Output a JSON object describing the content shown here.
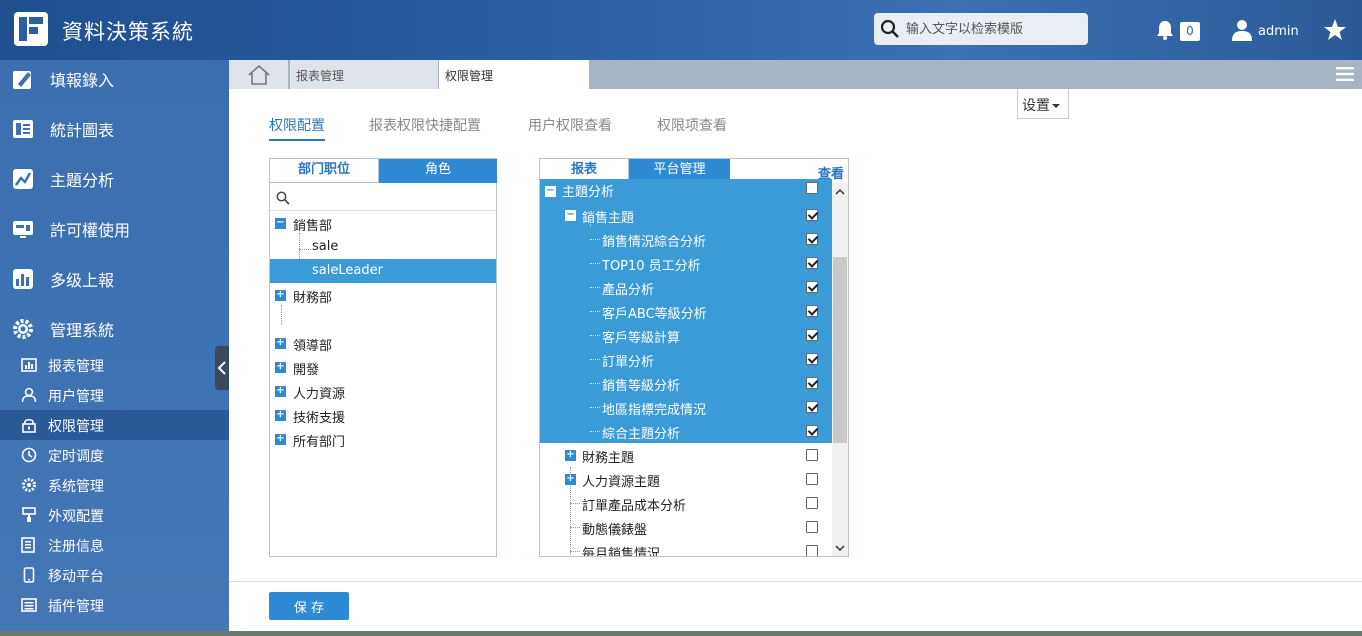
{
  "app": {
    "title": "資料決策系統"
  },
  "header": {
    "search_placeholder": "输入文字以检索模版",
    "notification_count": "0",
    "user": "admin"
  },
  "sidebar": {
    "main_items": [
      {
        "label": "填報錄入",
        "icon": "form-edit-icon"
      },
      {
        "label": "統計圖表",
        "icon": "chart-doc-icon"
      },
      {
        "label": "主題分析",
        "icon": "analysis-icon"
      },
      {
        "label": "許可權使用",
        "icon": "permission-icon"
      },
      {
        "label": "多级上報",
        "icon": "bar-chart-icon"
      },
      {
        "label": "管理系統",
        "icon": "gear-icon"
      }
    ],
    "sub_items": [
      {
        "label": "报表管理",
        "icon": "report-icon"
      },
      {
        "label": "用户管理",
        "icon": "user-icon"
      },
      {
        "label": "权限管理",
        "icon": "lock-icon",
        "active": true
      },
      {
        "label": "定时调度",
        "icon": "clock-icon"
      },
      {
        "label": "系统管理",
        "icon": "cog-icon"
      },
      {
        "label": "外观配置",
        "icon": "brush-icon"
      },
      {
        "label": "注册信息",
        "icon": "register-icon"
      },
      {
        "label": "移动平台",
        "icon": "mobile-icon"
      },
      {
        "label": "插件管理",
        "icon": "plugin-icon"
      }
    ]
  },
  "tabs": {
    "tab1": "报表管理",
    "tab2": "权限管理"
  },
  "settings_label": "设置",
  "sub_tabs": [
    "权限配置",
    "报表权限快捷配置",
    "用户权限查看",
    "权限项查看"
  ],
  "left_panel": {
    "tab1": "部门职位",
    "tab2": "角色",
    "tree": [
      {
        "label": "銷售部",
        "level": 0,
        "expanded": true
      },
      {
        "label": "sale",
        "level": 1
      },
      {
        "label": "saleLeader",
        "level": 1,
        "selected": true
      },
      {
        "label": "財務部",
        "level": 0,
        "expanded": false
      },
      {
        "label": "",
        "level": 1
      },
      {
        "label": "領導部",
        "level": 0,
        "expanded": false
      },
      {
        "label": "開發",
        "level": 0,
        "expanded": false
      },
      {
        "label": "人力資源",
        "level": 0,
        "expanded": false
      },
      {
        "label": "技術支援",
        "level": 0,
        "expanded": false
      },
      {
        "label": "所有部门",
        "level": 0,
        "expanded": false
      }
    ]
  },
  "right_panel": {
    "tab1": "报表",
    "tab2": "平台管理",
    "view_label": "查看",
    "rows": [
      {
        "label": "主題分析",
        "level": 0,
        "toggle": "minus",
        "checked": false,
        "selected": true
      },
      {
        "label": "銷售主題",
        "level": 1,
        "toggle": "minus",
        "checked": true,
        "selected": true
      },
      {
        "label": "銷售情況綜合分析",
        "level": 2,
        "checked": true,
        "selected": true
      },
      {
        "label": "TOP10 员工分析",
        "level": 2,
        "checked": true,
        "selected": true
      },
      {
        "label": "產品分析",
        "level": 2,
        "checked": true,
        "selected": true
      },
      {
        "label": "客戶ABC等級分析",
        "level": 2,
        "checked": true,
        "selected": true
      },
      {
        "label": "客戶等級計算",
        "level": 2,
        "checked": true,
        "selected": true
      },
      {
        "label": "訂單分析",
        "level": 2,
        "checked": true,
        "selected": true
      },
      {
        "label": "銷售等級分析",
        "level": 2,
        "checked": true,
        "selected": true
      },
      {
        "label": "地區指標完成情況",
        "level": 2,
        "checked": true,
        "selected": true
      },
      {
        "label": "綜合主題分析",
        "level": 2,
        "checked": true,
        "selected": true
      },
      {
        "label": "財務主題",
        "level": 1,
        "toggle": "plus",
        "checked": false
      },
      {
        "label": "人力資源主題",
        "level": 1,
        "toggle": "plus",
        "checked": false
      },
      {
        "label": "訂單產品成本分析",
        "level": 1,
        "checked": false
      },
      {
        "label": "動態儀錶盤",
        "level": 1,
        "checked": false
      },
      {
        "label": "每月銷售情況",
        "level": 1,
        "checked": false
      }
    ]
  },
  "footer": {
    "save_label": "保 存"
  },
  "colors": {
    "accent": "#2f8ad6",
    "sidebar": "#3d72b2",
    "selected_row": "#3b9bd7"
  }
}
